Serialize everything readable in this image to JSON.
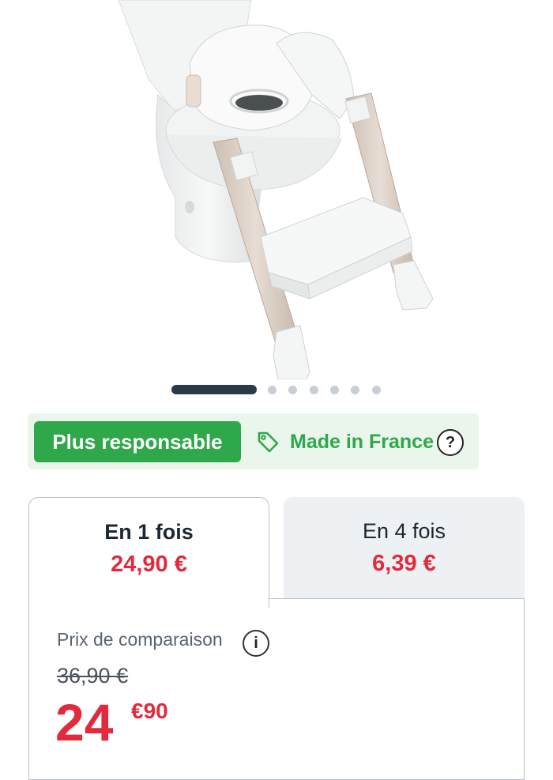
{
  "carousel": {
    "total_slides": 7,
    "active_index": 0
  },
  "badges": {
    "responsable": "Plus responsable",
    "made_in": "Made in France",
    "help": "?"
  },
  "payment_tabs": [
    {
      "label": "En 1 fois",
      "price": "24,90 €",
      "selected": true
    },
    {
      "label": "En 4 fois",
      "price": "6,39 €",
      "selected": false
    }
  ],
  "comparison": {
    "label": "Prix de comparaison",
    "info": "i",
    "old_price": "36,90 €"
  },
  "current_price": {
    "integer": "24",
    "decimal": "€90"
  },
  "colors": {
    "green": "#2ea84a",
    "red": "#e22a3d",
    "dark": "#2a3a48"
  },
  "icons": [
    "tag-icon",
    "help-icon",
    "info-icon"
  ]
}
